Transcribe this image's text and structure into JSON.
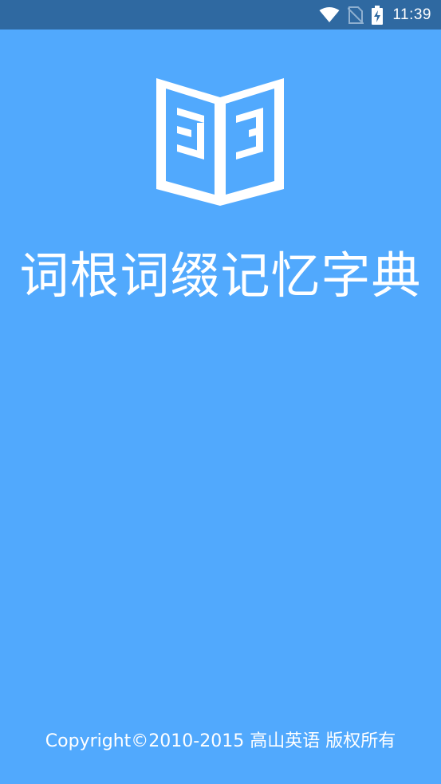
{
  "status_bar": {
    "time": "11:39",
    "icons": [
      "wifi-icon",
      "no-sim-icon",
      "battery-charging-icon"
    ]
  },
  "splash": {
    "logo_icon": "open-book-icon",
    "title": "词根词缀记忆字典",
    "copyright": "Copyright©2010-2015 高山英语 版权所有"
  },
  "colors": {
    "background": "#51a9fd",
    "status_bar": "#2f69a1",
    "foreground": "#ffffff"
  }
}
